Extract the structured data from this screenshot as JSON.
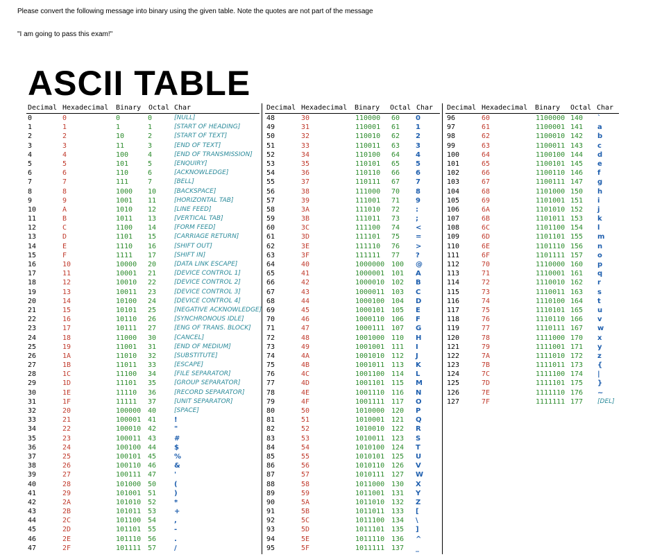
{
  "instruction": "Please convert the following message into binary using the given table. Note the quotes are not part of the message",
  "message": "\"I am going to pass this exam!\"",
  "title": "ASCII TABLE",
  "headers": [
    "Decimal",
    "Hexadecimal",
    "Binary",
    "Octal",
    "Char"
  ],
  "panels": [
    [
      [
        "0",
        "0",
        "0",
        "0",
        "[NULL]"
      ],
      [
        "1",
        "1",
        "1",
        "1",
        "[START OF HEADING]"
      ],
      [
        "2",
        "2",
        "10",
        "2",
        "[START OF TEXT]"
      ],
      [
        "3",
        "3",
        "11",
        "3",
        "[END OF TEXT]"
      ],
      [
        "4",
        "4",
        "100",
        "4",
        "[END OF TRANSMISSION]"
      ],
      [
        "5",
        "5",
        "101",
        "5",
        "[ENQUIRY]"
      ],
      [
        "6",
        "6",
        "110",
        "6",
        "[ACKNOWLEDGE]"
      ],
      [
        "7",
        "7",
        "111",
        "7",
        "[BELL]"
      ],
      [
        "8",
        "8",
        "1000",
        "10",
        "[BACKSPACE]"
      ],
      [
        "9",
        "9",
        "1001",
        "11",
        "[HORIZONTAL TAB]"
      ],
      [
        "10",
        "A",
        "1010",
        "12",
        "[LINE FEED]"
      ],
      [
        "11",
        "B",
        "1011",
        "13",
        "[VERTICAL TAB]"
      ],
      [
        "12",
        "C",
        "1100",
        "14",
        "[FORM FEED]"
      ],
      [
        "13",
        "D",
        "1101",
        "15",
        "[CARRIAGE RETURN]"
      ],
      [
        "14",
        "E",
        "1110",
        "16",
        "[SHIFT OUT]"
      ],
      [
        "15",
        "F",
        "1111",
        "17",
        "[SHIFT IN]"
      ],
      [
        "16",
        "10",
        "10000",
        "20",
        "[DATA LINK ESCAPE]"
      ],
      [
        "17",
        "11",
        "10001",
        "21",
        "[DEVICE CONTROL 1]"
      ],
      [
        "18",
        "12",
        "10010",
        "22",
        "[DEVICE CONTROL 2]"
      ],
      [
        "19",
        "13",
        "10011",
        "23",
        "[DEVICE CONTROL 3]"
      ],
      [
        "20",
        "14",
        "10100",
        "24",
        "[DEVICE CONTROL 4]"
      ],
      [
        "21",
        "15",
        "10101",
        "25",
        "[NEGATIVE ACKNOWLEDGE]"
      ],
      [
        "22",
        "16",
        "10110",
        "26",
        "[SYNCHRONOUS IDLE]"
      ],
      [
        "23",
        "17",
        "10111",
        "27",
        "[ENG OF TRANS. BLOCK]"
      ],
      [
        "24",
        "18",
        "11000",
        "30",
        "[CANCEL]"
      ],
      [
        "25",
        "19",
        "11001",
        "31",
        "[END OF MEDIUM]"
      ],
      [
        "26",
        "1A",
        "11010",
        "32",
        "[SUBSTITUTE]"
      ],
      [
        "27",
        "1B",
        "11011",
        "33",
        "[ESCAPE]"
      ],
      [
        "28",
        "1C",
        "11100",
        "34",
        "[FILE SEPARATOR]"
      ],
      [
        "29",
        "1D",
        "11101",
        "35",
        "[GROUP SEPARATOR]"
      ],
      [
        "30",
        "1E",
        "11110",
        "36",
        "[RECORD SEPARATOR]"
      ],
      [
        "31",
        "1F",
        "11111",
        "37",
        "[UNIT SEPARATOR]"
      ],
      [
        "32",
        "20",
        "100000",
        "40",
        "[SPACE]"
      ],
      [
        "33",
        "21",
        "100001",
        "41",
        "!"
      ],
      [
        "34",
        "22",
        "100010",
        "42",
        "\""
      ],
      [
        "35",
        "23",
        "100011",
        "43",
        "#"
      ],
      [
        "36",
        "24",
        "100100",
        "44",
        "$"
      ],
      [
        "37",
        "25",
        "100101",
        "45",
        "%"
      ],
      [
        "38",
        "26",
        "100110",
        "46",
        "&"
      ],
      [
        "39",
        "27",
        "100111",
        "47",
        "'"
      ],
      [
        "40",
        "28",
        "101000",
        "50",
        "("
      ],
      [
        "41",
        "29",
        "101001",
        "51",
        ")"
      ],
      [
        "42",
        "2A",
        "101010",
        "52",
        "*"
      ],
      [
        "43",
        "2B",
        "101011",
        "53",
        "+"
      ],
      [
        "44",
        "2C",
        "101100",
        "54",
        ","
      ],
      [
        "45",
        "2D",
        "101101",
        "55",
        "-"
      ],
      [
        "46",
        "2E",
        "101110",
        "56",
        "."
      ],
      [
        "47",
        "2F",
        "101111",
        "57",
        "/"
      ]
    ],
    [
      [
        "48",
        "30",
        "110000",
        "60",
        "0"
      ],
      [
        "49",
        "31",
        "110001",
        "61",
        "1"
      ],
      [
        "50",
        "32",
        "110010",
        "62",
        "2"
      ],
      [
        "51",
        "33",
        "110011",
        "63",
        "3"
      ],
      [
        "52",
        "34",
        "110100",
        "64",
        "4"
      ],
      [
        "53",
        "35",
        "110101",
        "65",
        "5"
      ],
      [
        "54",
        "36",
        "110110",
        "66",
        "6"
      ],
      [
        "55",
        "37",
        "110111",
        "67",
        "7"
      ],
      [
        "56",
        "38",
        "111000",
        "70",
        "8"
      ],
      [
        "57",
        "39",
        "111001",
        "71",
        "9"
      ],
      [
        "58",
        "3A",
        "111010",
        "72",
        ":"
      ],
      [
        "59",
        "3B",
        "111011",
        "73",
        ";"
      ],
      [
        "60",
        "3C",
        "111100",
        "74",
        "<"
      ],
      [
        "61",
        "3D",
        "111101",
        "75",
        "="
      ],
      [
        "62",
        "3E",
        "111110",
        "76",
        ">"
      ],
      [
        "63",
        "3F",
        "111111",
        "77",
        "?"
      ],
      [
        "64",
        "40",
        "1000000",
        "100",
        "@"
      ],
      [
        "65",
        "41",
        "1000001",
        "101",
        "A"
      ],
      [
        "66",
        "42",
        "1000010",
        "102",
        "B"
      ],
      [
        "67",
        "43",
        "1000011",
        "103",
        "C"
      ],
      [
        "68",
        "44",
        "1000100",
        "104",
        "D"
      ],
      [
        "69",
        "45",
        "1000101",
        "105",
        "E"
      ],
      [
        "70",
        "46",
        "1000110",
        "106",
        "F"
      ],
      [
        "71",
        "47",
        "1000111",
        "107",
        "G"
      ],
      [
        "72",
        "48",
        "1001000",
        "110",
        "H"
      ],
      [
        "73",
        "49",
        "1001001",
        "111",
        "I"
      ],
      [
        "74",
        "4A",
        "1001010",
        "112",
        "J"
      ],
      [
        "75",
        "4B",
        "1001011",
        "113",
        "K"
      ],
      [
        "76",
        "4C",
        "1001100",
        "114",
        "L"
      ],
      [
        "77",
        "4D",
        "1001101",
        "115",
        "M"
      ],
      [
        "78",
        "4E",
        "1001110",
        "116",
        "N"
      ],
      [
        "79",
        "4F",
        "1001111",
        "117",
        "O"
      ],
      [
        "80",
        "50",
        "1010000",
        "120",
        "P"
      ],
      [
        "81",
        "51",
        "1010001",
        "121",
        "Q"
      ],
      [
        "82",
        "52",
        "1010010",
        "122",
        "R"
      ],
      [
        "83",
        "53",
        "1010011",
        "123",
        "S"
      ],
      [
        "84",
        "54",
        "1010100",
        "124",
        "T"
      ],
      [
        "85",
        "55",
        "1010101",
        "125",
        "U"
      ],
      [
        "86",
        "56",
        "1010110",
        "126",
        "V"
      ],
      [
        "87",
        "57",
        "1010111",
        "127",
        "W"
      ],
      [
        "88",
        "58",
        "1011000",
        "130",
        "X"
      ],
      [
        "89",
        "59",
        "1011001",
        "131",
        "Y"
      ],
      [
        "90",
        "5A",
        "1011010",
        "132",
        "Z"
      ],
      [
        "91",
        "5B",
        "1011011",
        "133",
        "["
      ],
      [
        "92",
        "5C",
        "1011100",
        "134",
        "\\"
      ],
      [
        "93",
        "5D",
        "1011101",
        "135",
        "]"
      ],
      [
        "94",
        "5E",
        "1011110",
        "136",
        "^"
      ],
      [
        "95",
        "5F",
        "1011111",
        "137",
        "_"
      ]
    ],
    [
      [
        "96",
        "60",
        "1100000",
        "140",
        "`"
      ],
      [
        "97",
        "61",
        "1100001",
        "141",
        "a"
      ],
      [
        "98",
        "62",
        "1100010",
        "142",
        "b"
      ],
      [
        "99",
        "63",
        "1100011",
        "143",
        "c"
      ],
      [
        "100",
        "64",
        "1100100",
        "144",
        "d"
      ],
      [
        "101",
        "65",
        "1100101",
        "145",
        "e"
      ],
      [
        "102",
        "66",
        "1100110",
        "146",
        "f"
      ],
      [
        "103",
        "67",
        "1100111",
        "147",
        "g"
      ],
      [
        "104",
        "68",
        "1101000",
        "150",
        "h"
      ],
      [
        "105",
        "69",
        "1101001",
        "151",
        "i"
      ],
      [
        "106",
        "6A",
        "1101010",
        "152",
        "j"
      ],
      [
        "107",
        "6B",
        "1101011",
        "153",
        "k"
      ],
      [
        "108",
        "6C",
        "1101100",
        "154",
        "l"
      ],
      [
        "109",
        "6D",
        "1101101",
        "155",
        "m"
      ],
      [
        "110",
        "6E",
        "1101110",
        "156",
        "n"
      ],
      [
        "111",
        "6F",
        "1101111",
        "157",
        "o"
      ],
      [
        "112",
        "70",
        "1110000",
        "160",
        "p"
      ],
      [
        "113",
        "71",
        "1110001",
        "161",
        "q"
      ],
      [
        "114",
        "72",
        "1110010",
        "162",
        "r"
      ],
      [
        "115",
        "73",
        "1110011",
        "163",
        "s"
      ],
      [
        "116",
        "74",
        "1110100",
        "164",
        "t"
      ],
      [
        "117",
        "75",
        "1110101",
        "165",
        "u"
      ],
      [
        "118",
        "76",
        "1110110",
        "166",
        "v"
      ],
      [
        "119",
        "77",
        "1110111",
        "167",
        "w"
      ],
      [
        "120",
        "78",
        "1111000",
        "170",
        "x"
      ],
      [
        "121",
        "79",
        "1111001",
        "171",
        "y"
      ],
      [
        "122",
        "7A",
        "1111010",
        "172",
        "z"
      ],
      [
        "123",
        "7B",
        "1111011",
        "173",
        "{"
      ],
      [
        "124",
        "7C",
        "1111100",
        "174",
        "|"
      ],
      [
        "125",
        "7D",
        "1111101",
        "175",
        "}"
      ],
      [
        "126",
        "7E",
        "1111110",
        "176",
        "~"
      ],
      [
        "127",
        "7F",
        "1111111",
        "177",
        "[DEL]"
      ]
    ]
  ]
}
